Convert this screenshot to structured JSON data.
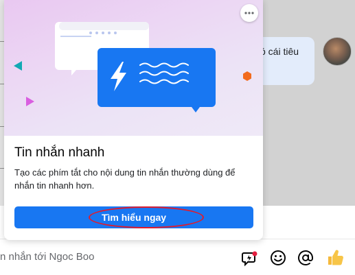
{
  "conversation": {
    "incoming_message_snippet": "có cái tiêu",
    "contact_avatar_alt": "Ngoc Boo avatar"
  },
  "popup": {
    "title": "Tin nhắn nhanh",
    "description": "Tạo các phím tắt cho nội dung tin nhắn thường dùng để nhắn tin nhanh hơn.",
    "cta_label": "Tìm hiểu ngay",
    "more_icon": "more-horizontal-icon",
    "hero_icons": [
      "chat-bubble-icon",
      "lightning-bolt-icon",
      "wave-lines-icon"
    ]
  },
  "composer": {
    "input_text": "n nhắn tới Ngoc Boo",
    "icons": [
      "quick-reply-icon",
      "emoji-icon",
      "mention-icon",
      "thumbs-up-icon"
    ]
  },
  "colors": {
    "accent": "#1877f2",
    "annotation": "#e21b2b",
    "teal": "#13a9b4",
    "magenta": "#d95ee0",
    "orange": "#f26b1d"
  }
}
